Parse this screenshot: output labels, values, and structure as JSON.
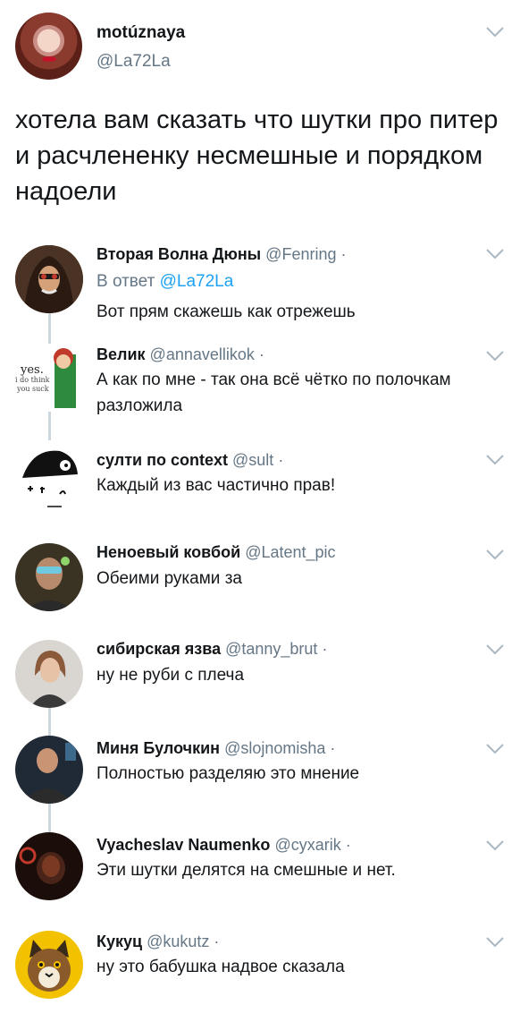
{
  "main_tweet": {
    "name": "motúznaya",
    "handle": "@La72La",
    "text": "хотела вам сказать что шутки про питер и расчлененку несмешные и порядком надоели"
  },
  "replies": [
    {
      "name": "Вторая Волна Дюны",
      "handle": "@Fenring",
      "dot": "·",
      "reply_prefix": "В ответ",
      "reply_to": "@La72La",
      "text": "Вот прям скажешь как отрежешь",
      "avatar_icon": "hooded-figure-avatar"
    },
    {
      "name": "Велик",
      "handle": "@annavellikok",
      "dot": "·",
      "text": "А как по мне - так она всё чётко по полочкам разложила",
      "avatar_icon": "meme-avatar",
      "avatar_text": [
        "yes.",
        "i do think",
        "you suck"
      ]
    },
    {
      "name": "султи по context",
      "handle": "@sult",
      "dot": "·",
      "text": "Каждый из вас частично прав!",
      "avatar_icon": "drawing-avatar"
    },
    {
      "name": "Неноевый ковбой",
      "handle": "@Latent_pic",
      "dot": "",
      "text": "Обеими руками за",
      "avatar_icon": "person-photo-avatar"
    },
    {
      "name": "сибирская язва",
      "handle": "@tanny_brut",
      "dot": "·",
      "text": "ну не руби с плеча",
      "avatar_icon": "person-photo-avatar"
    },
    {
      "name": "Миня Булочкин",
      "handle": "@slojnomisha",
      "dot": "·",
      "text": "Полностью разделяю это мнение",
      "avatar_icon": "person-photo-avatar"
    },
    {
      "name": "Vyacheslav Naumenko",
      "handle": "@cyxarik",
      "dot": "·",
      "text": "Эти шутки делятся на смешные и нет.",
      "avatar_icon": "dark-photo-avatar"
    },
    {
      "name": "Кукуц",
      "handle": "@kukutz",
      "dot": "·",
      "text": "ну это бабушка надвое сказала",
      "avatar_icon": "cat-avatar"
    }
  ],
  "icons": {
    "chevron": "chevron-down-icon"
  },
  "colors": {
    "text": "#14171a",
    "secondary": "#657786",
    "link": "#1da1f2",
    "thread_line": "#ccd6dd"
  }
}
